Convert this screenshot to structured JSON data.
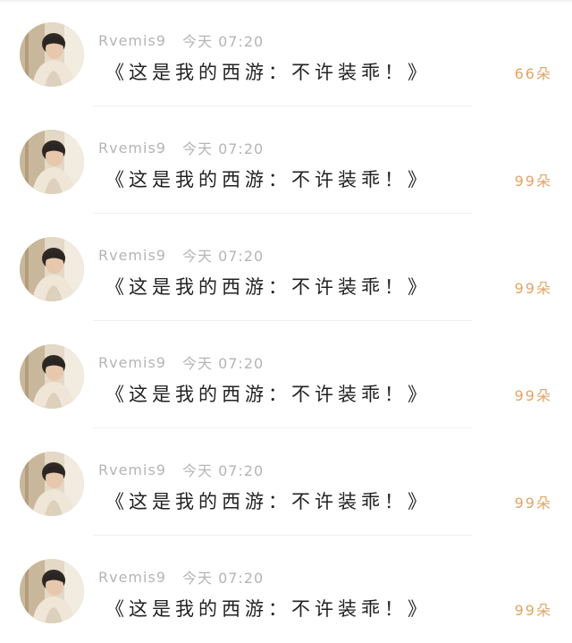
{
  "messages": [
    {
      "username": "Rvemis9",
      "time": "今天 07:20",
      "title": "《这是我的西游：不许装乖！》",
      "count": "66朵"
    },
    {
      "username": "Rvemis9",
      "time": "今天 07:20",
      "title": "《这是我的西游：不许装乖！》",
      "count": "99朵"
    },
    {
      "username": "Rvemis9",
      "time": "今天 07:20",
      "title": "《这是我的西游：不许装乖！》",
      "count": "99朵"
    },
    {
      "username": "Rvemis9",
      "time": "今天 07:20",
      "title": "《这是我的西游：不许装乖！》",
      "count": "99朵"
    },
    {
      "username": "Rvemis9",
      "time": "今天 07:20",
      "title": "《这是我的西游：不许装乖！》",
      "count": "99朵"
    },
    {
      "username": "Rvemis9",
      "time": "今天 07:20",
      "title": "《这是我的西游：不许装乖！》",
      "count": "99朵"
    }
  ],
  "colors": {
    "meta": "#b5b5b5",
    "title": "#222222",
    "count": "#e2a467",
    "divider": "#efefef"
  }
}
